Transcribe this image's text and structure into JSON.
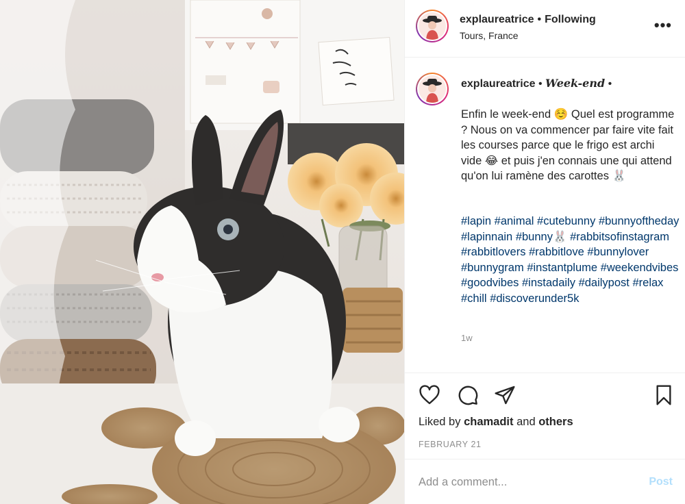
{
  "header": {
    "username": "explaureatrice",
    "separator": "•",
    "follow_status": "Following",
    "location": "Tours, France",
    "more_icon": "more-horizontal-icon",
    "more_label": "•••"
  },
  "caption": {
    "username": "explaureatrice",
    "separator_left": "•",
    "display_name": "Week-end",
    "separator_right": "•",
    "text": "Enfin le week-end ☺️ Quel est programme ? Nous on va commencer par faire vite fait les courses parce que le frigo est archi vide 😂 et puis j'en connais une qui attend qu'on lui ramène des carottes 🐰",
    "hashtags": [
      "#lapin",
      "#animal",
      "#cutebunny",
      "#bunnyoftheday",
      "#lapinnain",
      "#bunny",
      "#rabbitsofinstagram",
      "#rabbitlovers",
      "#rabbitlove",
      "#bunnylover",
      "#bunnygram",
      "#instantplume",
      "#weekendvibes",
      "#goodvibes",
      "#instadaily",
      "#dailypost",
      "#relax",
      "#chill",
      "#discoverunder5k"
    ],
    "hashtag_trailing_emoji": "🐰",
    "time_ago": "1w"
  },
  "actions": {
    "like_icon": "heart-icon",
    "comment_icon": "comment-icon",
    "share_icon": "paper-plane-icon",
    "save_icon": "bookmark-icon",
    "liked_by_prefix": "Liked by",
    "liked_by_user": "chamadit",
    "liked_by_and": "and",
    "liked_by_others": "others",
    "date": "FEBRUARY 21"
  },
  "comment_box": {
    "placeholder": "Add a comment...",
    "post_label": "Post"
  },
  "colors": {
    "text": "#262626",
    "secondary": "#8e8e8e",
    "hashtag": "#00376b",
    "post_disabled": "#b2dffc",
    "divider": "#efefef"
  }
}
